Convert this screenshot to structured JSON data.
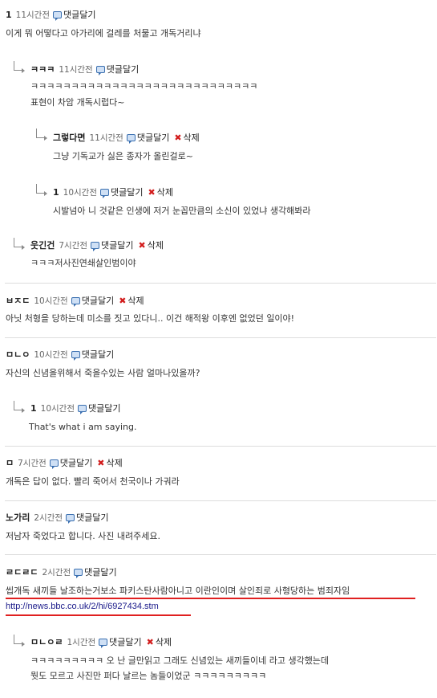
{
  "comments": [
    {
      "author": "1",
      "time": "11시간전",
      "reply": "댓글달기",
      "lines": [
        "이게 뭐 어떻다고 아가리에 걸레를 처물고 개독거리냐"
      ]
    },
    {
      "author": "ㅋㅋㅋ",
      "time": "11시간전",
      "reply": "댓글달기",
      "lines": [
        "ㅋㅋㅋㅋㅋㅋㅋㅋㅋㅋㅋㅋㅋㅋㅋㅋㅋㅋㅋㅋㅋㅋㅋㅋㅋㅋㅋㅋ",
        "표현이 차암 개독시럽다~"
      ]
    },
    {
      "author": "그렇다면",
      "time": "11시간전",
      "reply": "댓글달기",
      "delete": "삭제",
      "lines": [
        "그냥 기독교가 싫은 종자가 올린걸로~"
      ]
    },
    {
      "author": "1",
      "time": "10시간전",
      "reply": "댓글달기",
      "delete": "삭제",
      "lines": [
        "시발넘아 니 것같은 인생에 저거 눈꼽만큼의 소신이 있었냐 생각해봐라"
      ]
    },
    {
      "author": "웃긴건",
      "time": "7시간전",
      "reply": "댓글달기",
      "delete": "삭제",
      "lines": [
        "ㅋㅋㅋ저사진연쇄살인범이야"
      ]
    },
    {
      "author": "ㅂㅈㄷ",
      "time": "10시간전",
      "reply": "댓글달기",
      "delete": "삭제",
      "lines": [
        "아닛 처형을 당하는데 미소를 짓고 있다니.. 이건 해적왕 이후엔 없었던 일이야!"
      ]
    },
    {
      "author": "ㅁㄴㅇ",
      "time": "10시간전",
      "reply": "댓글달기",
      "lines": [
        "자신의 신념을위해서 죽을수있는 사람 얼마나있을까?"
      ]
    },
    {
      "author": "1",
      "time": "10시간전",
      "reply": "댓글달기",
      "lines": [
        "That's what i am saying."
      ]
    },
    {
      "author": "ㅁ",
      "time": "7시간전",
      "reply": "댓글달기",
      "delete": "삭제",
      "lines": [
        "개독은 답이 없다. 빨리 죽어서 천국이나 가궈라"
      ]
    },
    {
      "author": "노가리",
      "time": "2시간전",
      "reply": "댓글달기",
      "lines": [
        "저남자 죽었다고 합니다. 사진 내려주세요."
      ]
    },
    {
      "author": "ㄹㄷㄹㄷ",
      "time": "2시간전",
      "reply": "댓글달기",
      "lines": [
        "씹개독 새끼들 날조하는거보소 파키스탄사람아니고 이란인이며 살인죄로 사형당하는 범죄자임"
      ],
      "link": "http://news.bbc.co.uk/2/hi/6927434.stm"
    },
    {
      "author": "ㅁㄴㅇㄹ",
      "time": "1시간전",
      "reply": "댓글달기",
      "delete": "삭제",
      "lines": [
        "ㅋㅋㅋㅋㅋㅋㅋㅋㅋ 오 난 글만읽고 그래도 신념있는 새끼들이네 라고 생각했는데",
        "뭣도 모르고 사진만 퍼다 날르는 놈들이었군 ㅋㅋㅋㅋㅋㅋㅋㅋㅋ"
      ]
    }
  ],
  "colors": {
    "underline": "#e02020",
    "link": "#1a1a8a",
    "delete_icon": "#d21c1c",
    "reply_icon": "#3a6fb0"
  }
}
